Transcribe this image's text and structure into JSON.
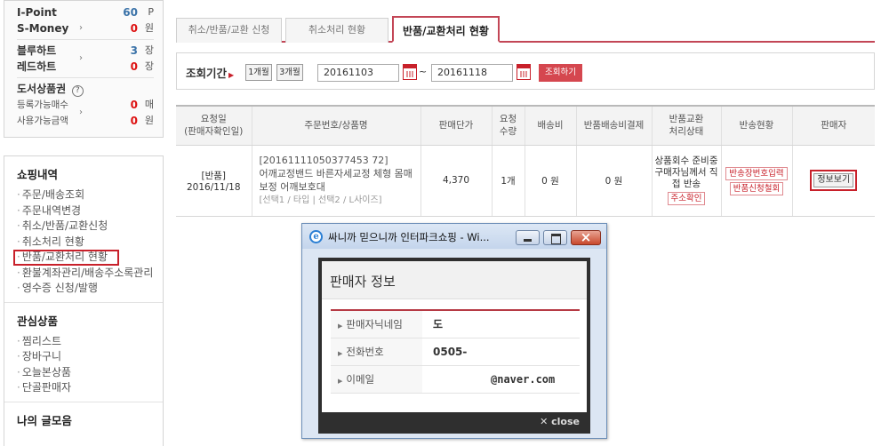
{
  "points": {
    "ipoint": {
      "label": "I-Point",
      "value": "60",
      "unit": "P"
    },
    "smoney": {
      "label": "S-Money",
      "value": "0",
      "unit": "원"
    },
    "bluehart": {
      "label": "블루하트",
      "value": "3",
      "unit": "장"
    },
    "redhart": {
      "label": "레드하트",
      "value": "0",
      "unit": "장"
    },
    "giftcard": {
      "label": "도서상품권",
      "help": "?"
    },
    "reg_count": {
      "label": "등록가능매수",
      "value": "0",
      "unit": "매"
    },
    "avail_amount": {
      "label": "사용가능금액",
      "value": "0",
      "unit": "원"
    }
  },
  "sidebar": {
    "shopping": {
      "title": "쇼핑내역",
      "items": [
        "주문/배송조회",
        "주문내역변경",
        "취소/반품/교환신청",
        "취소처리 현황",
        "반품/교환처리 현황",
        "환불계좌관리/배송주소록관리",
        "영수증 신청/발행"
      ]
    },
    "interest": {
      "title": "관심상품",
      "items": [
        "찜리스트",
        "장바구니",
        "오늘본상품",
        "단골판매자"
      ]
    },
    "my_posts": {
      "title": "나의 글모음"
    }
  },
  "tabs": [
    "취소/반품/교환 신청",
    "취소처리 현황",
    "반품/교환처리 현황"
  ],
  "search": {
    "label": "조회기간",
    "btn_1m": "1개월",
    "btn_3m": "3개월",
    "from_date": "20161103",
    "tilde": "~",
    "to_date": "20161118",
    "submit": "조회하기"
  },
  "table": {
    "headers": [
      "요청일\n(판매자확인일)",
      "주문번호/상품명",
      "판매단가",
      "요청\n수량",
      "배송비",
      "반품배송비결제",
      "반품교환\n처리상태",
      "반송현황",
      "판매자"
    ],
    "row": {
      "type": "[반품]",
      "date": "2016/11/18",
      "order_no": "[20161111050377453 72]",
      "product": "어깨교정밴드 바른자세교정 체형 몸매보정 어깨보호대",
      "option": "[선택1 / 타입 | 선택2 / L사이즈]",
      "price": "4,370",
      "qty": "1개",
      "shipping": "0 원",
      "return_shipping": "0 원",
      "status": "상품회수 준비중 구매자님께서 직접 반송",
      "address_btn": "주소확인",
      "invoice_btn": "반송장번호입력",
      "cancel_btn": "반품신청철회",
      "seller_btn": "정보보기"
    }
  },
  "popup": {
    "title": "싸니까 믿으니까 인터파크쇼핑 - Wi...",
    "heading": "판매자 정보",
    "rows": [
      {
        "label": "판매자닉네임",
        "value": "도"
      },
      {
        "label": "전화번호",
        "value": "0505-"
      },
      {
        "label": "이메일",
        "value": "@naver.com"
      }
    ],
    "close": "close"
  }
}
